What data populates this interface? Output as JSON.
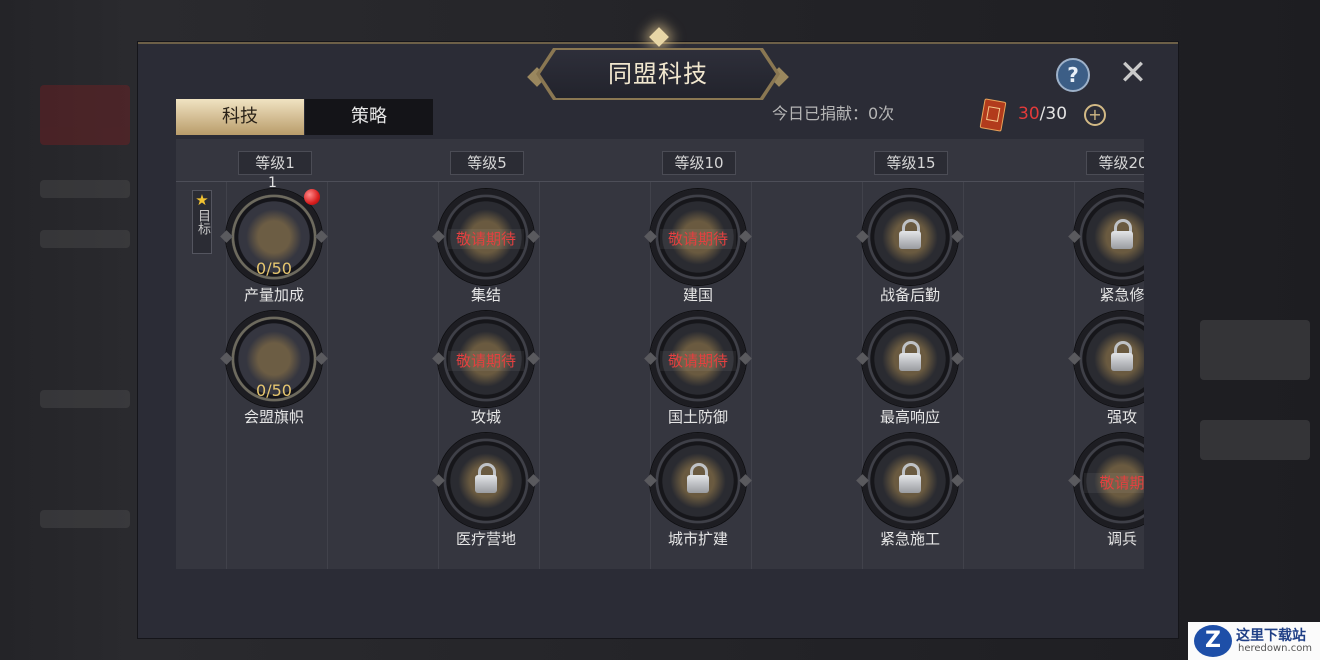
{
  "panel": {
    "title": "同盟科技",
    "help_symbol": "?",
    "close_symbol": "✕"
  },
  "tabs": [
    {
      "label": "科技",
      "active": true
    },
    {
      "label": "策略",
      "active": false
    }
  ],
  "donation": {
    "label": "今日已捐献：0次",
    "current": "30",
    "separator": "/",
    "max": "30",
    "plus_symbol": "+"
  },
  "target_badge": {
    "star": "★",
    "text": "目标"
  },
  "levels": [
    "等级1",
    "等级5",
    "等级10",
    "等级15",
    "等级20"
  ],
  "nodes": {
    "n1": {
      "name": "产量加成",
      "progress": "0/50",
      "count": "1"
    },
    "n2": {
      "name": "会盟旗帜",
      "progress": "0/50"
    },
    "n3": {
      "name": "集结",
      "status": "敬请期待"
    },
    "n4": {
      "name": "攻城",
      "status": "敬请期待"
    },
    "n5": {
      "name": "医疗营地"
    },
    "n6": {
      "name": "建国",
      "status": "敬请期待"
    },
    "n7": {
      "name": "国土防御",
      "status": "敬请期待"
    },
    "n8": {
      "name": "城市扩建"
    },
    "n9": {
      "name": "战备后勤"
    },
    "n10": {
      "name": "最高响应"
    },
    "n11": {
      "name": "紧急施工"
    },
    "n12": {
      "name": "紧急修"
    },
    "n13": {
      "name": "强攻"
    },
    "n14": {
      "name": "调兵",
      "status": "敬请期"
    }
  },
  "icons": {
    "locked": "lock-icon",
    "help": "question-mark-icon",
    "close": "close-icon",
    "ticket": "donation-ticket-icon"
  },
  "colors": {
    "accent_gold": "#d2b985",
    "coming_soon_red": "#e34040",
    "progress_gold": "#e6c66f",
    "notify_red": "#d91e1e"
  },
  "watermark": {
    "logo": "Z",
    "title": "这里下载站",
    "subtitle": "heredown.com"
  }
}
